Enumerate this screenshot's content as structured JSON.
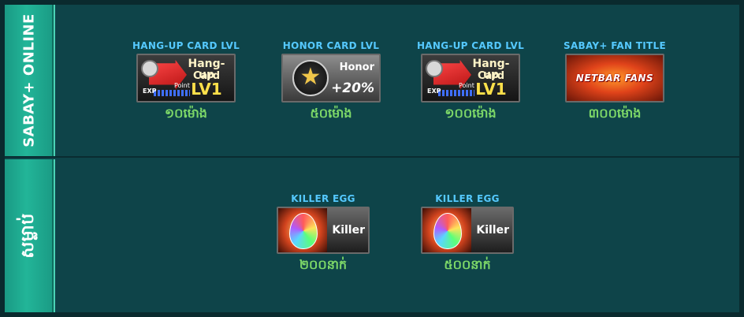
{
  "rows": [
    {
      "label": "SABAY+ ONLINE",
      "items": [
        {
          "title": "Hang-Up Card LVl",
          "value": "១០ម៉ោង",
          "card": {
            "line1": "Hang-up",
            "line2": "Card",
            "line3": "LV1",
            "exp": "EXP",
            "point": "Point"
          }
        },
        {
          "title": "Honor Card LVl",
          "value": "៥០ម៉ោង",
          "card": {
            "line1": "Honor",
            "line2": "+20%"
          }
        },
        {
          "title": "Hang-Up Card LVl",
          "value": "១០០ម៉ោង",
          "card": {
            "line1": "Hang-up",
            "line2": "Card",
            "line3": "LV1",
            "exp": "EXP",
            "point": "Point"
          }
        },
        {
          "title": "Sabay+ Fan Title",
          "value": "៣០០ម៉ោង",
          "card": {
            "line1": "NETBAR FANS"
          }
        }
      ]
    },
    {
      "label": "សម្លាប់",
      "items": [
        {
          "title": "Killer Egg",
          "value": "២០០នាក់",
          "card": {
            "line1": "Killer"
          }
        },
        {
          "title": "Killer Egg",
          "value": "៥០០នាក់",
          "card": {
            "line1": "Killer"
          }
        }
      ]
    }
  ],
  "colors": {
    "panel": "#0e4449",
    "side": "#22b598",
    "title": "#55c9ff",
    "value": "#7dd868"
  }
}
